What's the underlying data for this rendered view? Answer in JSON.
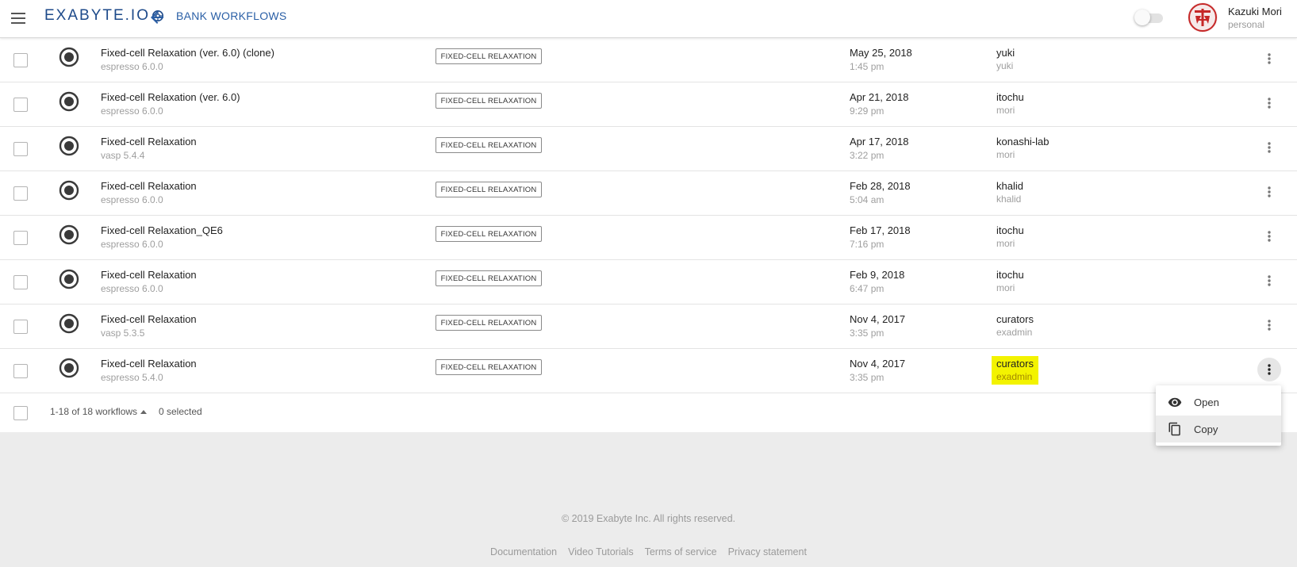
{
  "header": {
    "logo_text": "EXABYTE.IO",
    "page_title": "BANK WORKFLOWS",
    "user_name": "Kazuki Mori",
    "user_account": "personal",
    "accent_color": "#1d4a8a"
  },
  "rows": [
    {
      "name": "Fixed-cell Relaxation (ver. 6.0) (clone)",
      "sub": "espresso 6.0.0",
      "tag": "FIXED-CELL RELAXATION",
      "date": "May 25, 2018",
      "time": "1:45 pm",
      "owner": "yuki",
      "owner_sub": "yuki"
    },
    {
      "name": "Fixed-cell Relaxation (ver. 6.0)",
      "sub": "espresso 6.0.0",
      "tag": "FIXED-CELL RELAXATION",
      "date": "Apr 21, 2018",
      "time": "9:29 pm",
      "owner": "itochu",
      "owner_sub": "mori"
    },
    {
      "name": "Fixed-cell Relaxation",
      "sub": "vasp 5.4.4",
      "tag": "FIXED-CELL RELAXATION",
      "date": "Apr 17, 2018",
      "time": "3:22 pm",
      "owner": "konashi-lab",
      "owner_sub": "mori"
    },
    {
      "name": "Fixed-cell Relaxation",
      "sub": "espresso 6.0.0",
      "tag": "FIXED-CELL RELAXATION",
      "date": "Feb 28, 2018",
      "time": "5:04 am",
      "owner": "khalid",
      "owner_sub": "khalid"
    },
    {
      "name": "Fixed-cell Relaxation_QE6",
      "sub": "espresso 6.0.0",
      "tag": "FIXED-CELL RELAXATION",
      "date": "Feb 17, 2018",
      "time": "7:16 pm",
      "owner": "itochu",
      "owner_sub": "mori"
    },
    {
      "name": "Fixed-cell Relaxation",
      "sub": "espresso 6.0.0",
      "tag": "FIXED-CELL RELAXATION",
      "date": "Feb 9, 2018",
      "time": "6:47 pm",
      "owner": "itochu",
      "owner_sub": "mori"
    },
    {
      "name": "Fixed-cell Relaxation",
      "sub": "vasp 5.3.5",
      "tag": "FIXED-CELL RELAXATION",
      "date": "Nov 4, 2017",
      "time": "3:35 pm",
      "owner": "curators",
      "owner_sub": "exadmin"
    },
    {
      "name": "Fixed-cell Relaxation",
      "sub": "espresso 5.4.0",
      "tag": "FIXED-CELL RELAXATION",
      "date": "Nov 4, 2017",
      "time": "3:35 pm",
      "owner": "curators",
      "owner_sub": "exadmin",
      "highlight_color": "#f3f300"
    }
  ],
  "list_footer": {
    "count": "1-18 of 18 workflows",
    "selected": "0 selected"
  },
  "context_menu": {
    "items": [
      {
        "label": "Open",
        "icon": "eye-icon"
      },
      {
        "label": "Copy",
        "icon": "copy-icon"
      }
    ]
  },
  "footer": {
    "copyright": "© 2019 Exabyte Inc. All rights reserved.",
    "links": [
      "Documentation",
      "Video Tutorials",
      "Terms of service",
      "Privacy statement"
    ]
  }
}
